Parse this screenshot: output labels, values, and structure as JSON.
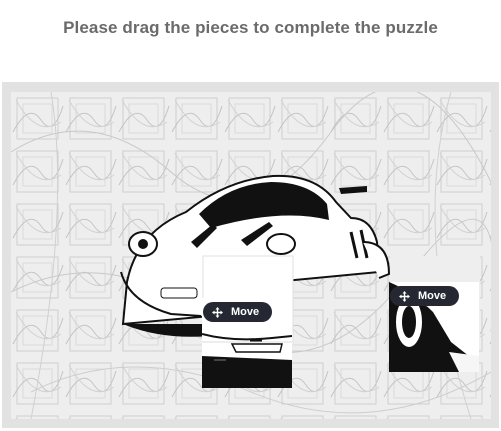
{
  "title": "Please drag the pieces to complete the puzzle",
  "pieces": [
    {
      "move_label": "Move",
      "icon": "move-arrows-icon"
    },
    {
      "move_label": "Move",
      "icon": "move-arrows-icon"
    }
  ],
  "colors": {
    "title": "#6b6b6b",
    "frame": "#e2e2e2",
    "canvas": "#eeeeee",
    "move_button": "#252733",
    "car_outline": "#111111"
  }
}
